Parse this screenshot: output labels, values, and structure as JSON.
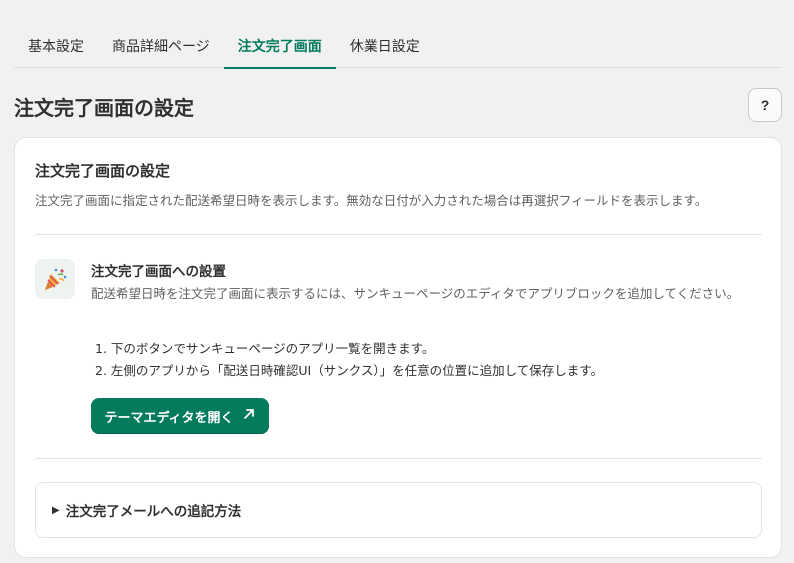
{
  "tabs": [
    {
      "label": "基本設定",
      "active": false
    },
    {
      "label": "商品詳細ページ",
      "active": false
    },
    {
      "label": "注文完了画面",
      "active": true
    },
    {
      "label": "休業日設定",
      "active": false
    }
  ],
  "page": {
    "title": "注文完了画面の設定",
    "help_label": "?"
  },
  "card": {
    "title": "注文完了画面の設定",
    "description": "注文完了画面に指定された配送希望日時を表示します。無効な日付が入力された場合は再選択フィールドを表示します。",
    "section": {
      "icon": "party-popper-icon",
      "title": "注文完了画面への設置",
      "description": "配送希望日時を注文完了画面に表示するには、サンキューページのエディタでアプリブロックを追加してください。",
      "steps": [
        "1. 下のボタンでサンキューページのアプリ一覧を開きます。",
        "2. 左側のアプリから「配送日時確認UI（サンクス）」を任意の位置に追加して保存します。"
      ],
      "button_label": "テーマエディタを開く"
    },
    "collapsible_label": "注文完了メールへの追記方法"
  },
  "colors": {
    "accent": "#047b5d",
    "background": "#f1f1f1",
    "card": "#ffffff"
  }
}
